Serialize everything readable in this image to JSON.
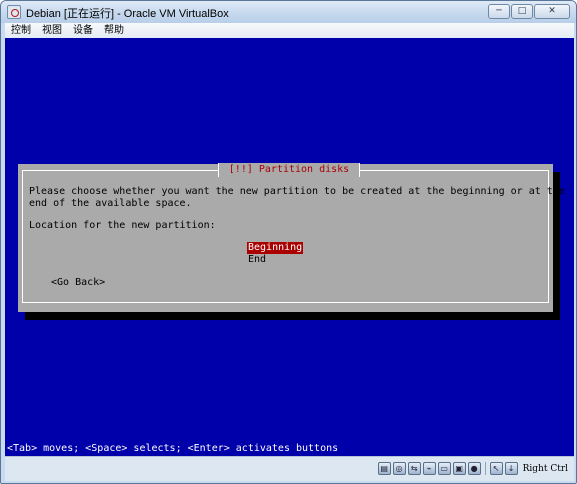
{
  "window": {
    "title": "Debian [正在运行] - Oracle VM VirtualBox",
    "controls": {
      "minimize": "─",
      "maximize": "□",
      "close": "✕"
    }
  },
  "menu": [
    "控制",
    "视图",
    "设备",
    "帮助"
  ],
  "installer": {
    "dialog_title": "[!!] Partition disks",
    "prompt_line1": "Please choose whether you want the new partition to be created at the beginning or at the",
    "prompt_line2": "end of the available space.",
    "question": "Location for the new partition:",
    "options": [
      "Beginning",
      "End"
    ],
    "selected_option": "Beginning",
    "go_back": "<Go Back>",
    "help_line": "<Tab> moves; <Space> selects; <Enter> activates buttons"
  },
  "statusbar": {
    "icons": [
      "hard-disk-icon",
      "optical-disc-icon",
      "network-icon",
      "usb-icon",
      "shared-folder-icon",
      "display-icon",
      "video-capture-icon",
      "mouse-integration-icon",
      "keyboard-capture-icon"
    ],
    "host_key": "Right Ctrl"
  },
  "colors": {
    "screen_bg": "#0000aa",
    "dialog_bg": "#aaaaaa",
    "dialog_title": "#aa0000",
    "selection_bg": "#aa0000",
    "selection_fg": "#ffffff",
    "help_text": "#ffffff"
  }
}
